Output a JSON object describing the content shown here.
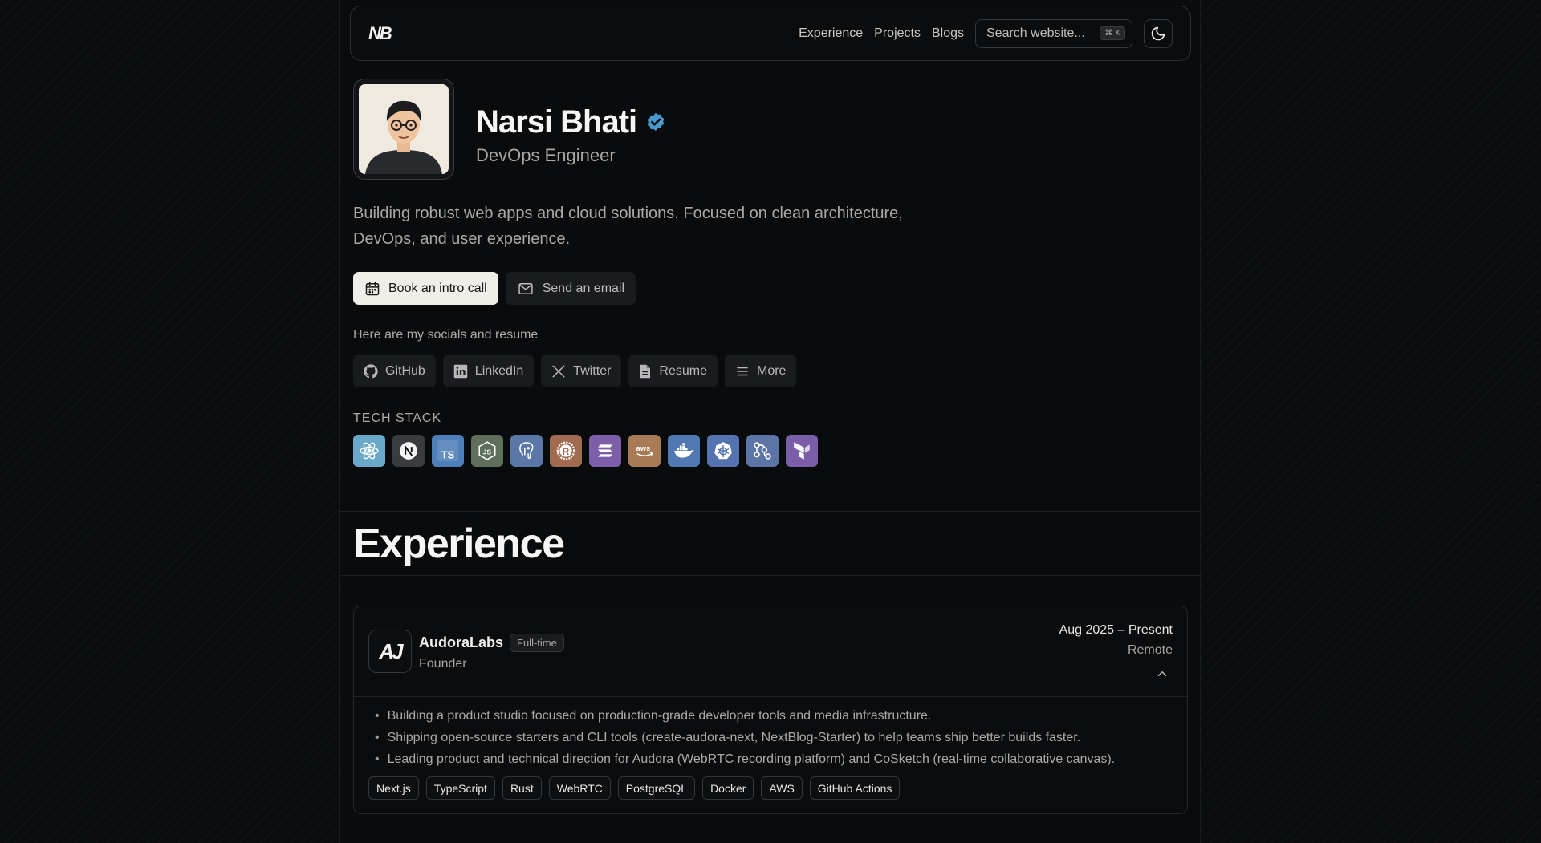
{
  "nav": {
    "logo": "NB",
    "links": [
      "Experience",
      "Projects",
      "Blogs"
    ],
    "search_placeholder": "Search website...",
    "search_shortcut": "⌘ K",
    "theme_icon": "moon-icon"
  },
  "profile": {
    "name": "Narsi Bhati",
    "role": "DevOps Engineer",
    "verified_icon": "verified-badge-icon",
    "bio": "Building robust web apps and cloud solutions. Focused on clean architecture, DevOps, and user experience.",
    "cta_primary": "Book an intro call",
    "cta_secondary": "Send an email"
  },
  "socials": {
    "label": "Here are my socials and resume",
    "items": [
      "GitHub",
      "LinkedIn",
      "Twitter",
      "Resume",
      "More"
    ]
  },
  "tech_stack": {
    "label": "TECH STACK",
    "items": [
      {
        "name": "react-icon",
        "color": "#6aa8c9"
      },
      {
        "name": "nextjs-icon",
        "color": "#3a3b3e"
      },
      {
        "name": "typescript-icon",
        "color": "#4f7fb8"
      },
      {
        "name": "nodejs-icon",
        "color": "#5f6f5c"
      },
      {
        "name": "postgresql-icon",
        "color": "#5a77a8"
      },
      {
        "name": "rust-icon",
        "color": "#a06b4f"
      },
      {
        "name": "solana-icon",
        "color": "#7c5fa8"
      },
      {
        "name": "aws-icon",
        "color": "#a87a55"
      },
      {
        "name": "docker-icon",
        "color": "#4f79b0"
      },
      {
        "name": "kubernetes-icon",
        "color": "#5573b0"
      },
      {
        "name": "github-actions-icon",
        "color": "#5d74a6"
      },
      {
        "name": "terraform-icon",
        "color": "#7a5ea8"
      }
    ]
  },
  "experience": {
    "heading": "Experience",
    "jobs": [
      {
        "company": "AudoraLabs",
        "logo": "AJ",
        "type": "Full-time",
        "position": "Founder",
        "dates": "Aug 2025 – Present",
        "location": "Remote",
        "bullets": [
          "Building a product studio focused on production-grade developer tools and media infrastructure.",
          "Shipping open-source starters and CLI tools (create-audora-next, NextBlog-Starter) to help teams ship better builds faster.",
          "Leading product and technical direction for Audora (WebRTC recording platform) and CoSketch (real-time collaborative canvas)."
        ],
        "tags": [
          "Next.js",
          "TypeScript",
          "Rust",
          "WebRTC",
          "PostgreSQL",
          "Docker",
          "AWS",
          "GitHub Actions"
        ]
      }
    ]
  }
}
